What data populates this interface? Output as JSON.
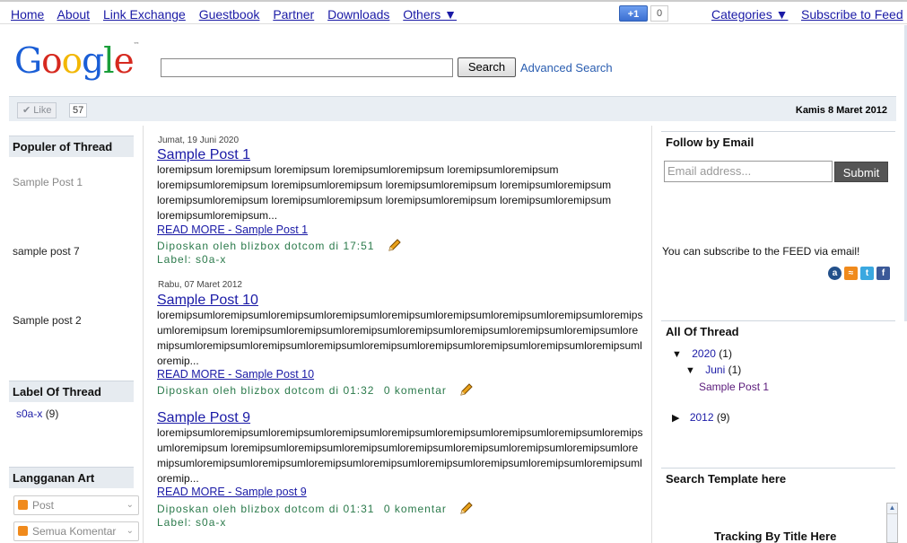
{
  "nav": {
    "links": [
      "Home",
      "About",
      "Link Exchange",
      "Guestbook",
      "Partner",
      "Downloads",
      "Others ▼"
    ],
    "plusone_label": "+1",
    "plusone_count": "0",
    "categories": "Categories ▼",
    "subscribe": "Subscribe to Feed"
  },
  "header": {
    "search_button": "Search",
    "advanced_search": "Advanced Search"
  },
  "likebar": {
    "like_label": "✔ Like",
    "like_count": "57",
    "date": "Kamis 8 Maret 2012"
  },
  "left": {
    "popular_heading": "Populer of Thread",
    "popular_posts": [
      "Sample Post 1",
      "sample post 7",
      "Sample post 2"
    ],
    "label_heading": "Label Of Thread",
    "label_name": "s0a-x",
    "label_count": "(9)",
    "subscribe_heading": "Langganan Art",
    "select_post": "Post",
    "select_comments": "Semua Komentar"
  },
  "posts": [
    {
      "date": "Jumat, 19 Juni 2020",
      "title": "Sample Post 1",
      "body": "loremipsum loremipsum loremipsum loremipsumloremipsum loremipsumloremipsum loremipsumloremipsum loremipsumloremipsum loremipsumloremipsum loremipsumloremipsum loremipsumloremipsum loremipsumloremipsum loremipsumloremipsum loremipsumloremipsum loremipsumloremipsum...",
      "read_more": "READ MORE - Sample Post 1",
      "meta": "Diposkan oleh blizbox dotcom di",
      "time": "17:51",
      "label": "Label: s0a-x"
    },
    {
      "date": "Rabu, 07 Maret 2012",
      "title": "Sample Post 10",
      "body": "loremipsumloremipsumloremipsumloremipsumloremipsumloremipsumloremipsumloremipsumloremipsumloremipsum loremipsumloremipsumloremipsumloremipsumloremipsumloremipsumloremipsumloremipsumloremipsumloremipsumloremipsumloremipsumloremipsumloremipsumloremipsumloremipsumloremip...",
      "read_more": "READ MORE - Sample Post 10",
      "meta": "Diposkan oleh blizbox dotcom di",
      "time": "01:32",
      "comments": "0 komentar"
    },
    {
      "title": "Sample Post 9",
      "body": "loremipsumloremipsumloremipsumloremipsumloremipsumloremipsumloremipsumloremipsumloremipsumloremipsum loremipsumloremipsumloremipsumloremipsumloremipsumloremipsumloremipsumloremipsumloremipsumloremipsumloremipsumloremipsumloremipsumloremipsumloremipsumloremipsumloremip...",
      "read_more": "READ MORE - Sample post 9",
      "meta": "Diposkan oleh blizbox dotcom di",
      "time": "01:31",
      "comments": "0 komentar",
      "label": "Label: s0a-x"
    }
  ],
  "right": {
    "follow_heading": "Follow by Email",
    "email_placeholder": "Email address...",
    "submit": "Submit",
    "feed_note": "You can subscribe to the FEED via email!",
    "archive_heading": "All Of Thread",
    "year_2020": "2020",
    "year_2020_count": "(1)",
    "month_juni": "Juni",
    "month_juni_count": "(1)",
    "archive_post": "Sample Post 1",
    "year_2012": "2012",
    "year_2012_count": "(9)",
    "search_heading": "Search Template here",
    "tracking": "Tracking By Title Here"
  },
  "colors": {
    "meta_green": "#2b7a4b",
    "link_blue": "#1a1aa6",
    "header_bg": "#e6ebf0"
  }
}
